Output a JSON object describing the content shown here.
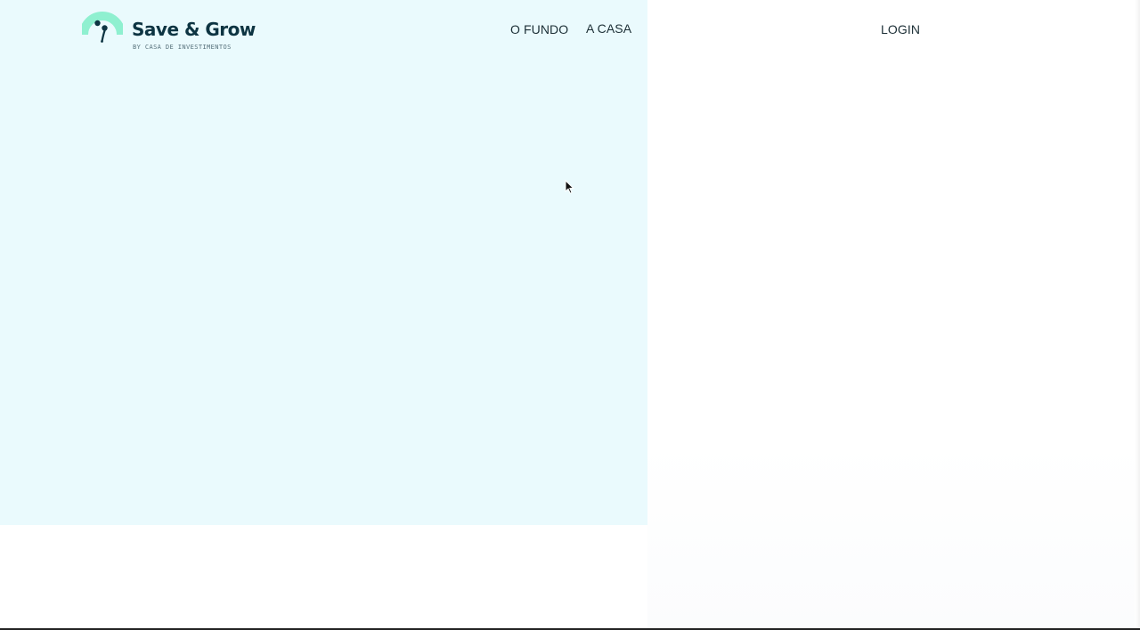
{
  "header": {
    "brand": {
      "name": "Save & Grow",
      "tagline": "BY CASA DE INVESTIMENTOS",
      "icon": "save-and-grow-logo-icon"
    },
    "nav": [
      {
        "label": "O FUNDO"
      },
      {
        "label": "A CASA"
      }
    ],
    "login_label": "LOGIN"
  },
  "colors": {
    "hero_background": "#eafafd",
    "logo_accent": "#8ff0d0",
    "brand_text": "#0d3442",
    "nav_text": "#1c2f36"
  },
  "pointer": {
    "icon": "mouse-pointer-icon"
  }
}
